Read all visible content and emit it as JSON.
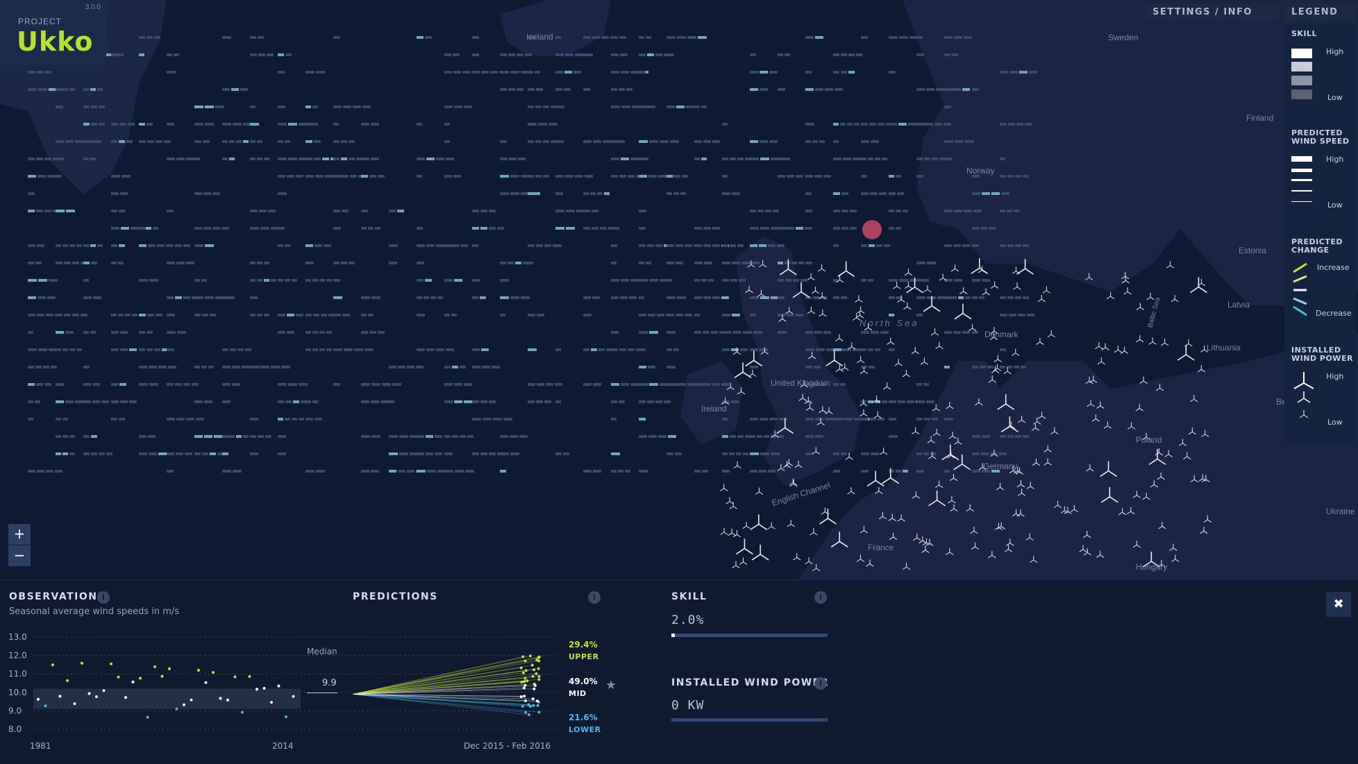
{
  "app": {
    "project_label": "PROJECT",
    "name": "Ukko",
    "version": "3.0.0"
  },
  "top_tabs": {
    "settings": "SETTINGS / INFO",
    "legend": "LEGEND"
  },
  "legend": {
    "skill": {
      "title": "SKILL",
      "high": "High",
      "low": "Low"
    },
    "wind_speed": {
      "title_line1": "PREDICTED",
      "title_line2": "WIND SPEED",
      "high": "High",
      "low": "Low"
    },
    "change": {
      "title_line1": "PREDICTED",
      "title_line2": "CHANGE",
      "increase": "Increase",
      "decrease": "Decrease"
    },
    "installed": {
      "title_line1": "INSTALLED",
      "title_line2": "WIND POWER",
      "high": "High",
      "low": "Low"
    }
  },
  "map": {
    "labels": {
      "iceland": "Iceland",
      "sweden": "Sweden",
      "finland": "Finland",
      "norway": "Norway",
      "estonia": "Estonia",
      "latvia": "Latvia",
      "lithuania": "Lithuania",
      "north_sea": "North Sea",
      "united_kingdom": "United Kingdom",
      "ireland": "Ireland",
      "denmark": "Denmark",
      "germany": "Germany",
      "poland": "Poland",
      "english_channel": "English Channel",
      "france": "France",
      "hungary": "Hungary",
      "ukraine": "Ukraine",
      "baltic": "Baltic Sea",
      "belarus": "Be"
    },
    "colors": {
      "land": "#1c2446",
      "sea": "#0e1a33",
      "marker": "#c74a6a"
    }
  },
  "zoom": {
    "in": "+",
    "out": "−"
  },
  "observations": {
    "title": "OBSERVATIONS",
    "info": "i",
    "subtitle": "Seasonal average wind speeds in m/s",
    "y_ticks": [
      "13.0",
      "12.0",
      "11.0",
      "10.0",
      "9.0",
      "8.0"
    ],
    "x_start": "1981",
    "x_end": "2014",
    "median_label": "Median",
    "median_value": "9.9"
  },
  "predictions": {
    "title": "PREDICTIONS",
    "info": "i",
    "period": "Dec 2015 - Feb 2016",
    "upper_pct": "29.4%",
    "upper_label": "UPPER",
    "mid_pct": "49.0%",
    "mid_label": "MID",
    "lower_pct": "21.6%",
    "lower_label": "LOWER",
    "star": "★",
    "colors": {
      "upper": "#c8e03a",
      "mid": "#ffffff",
      "lower": "#4fb6e6"
    }
  },
  "skill": {
    "title": "SKILL",
    "info": "i",
    "value": "2.0%",
    "fraction": 0.02
  },
  "installed_power": {
    "title": "INSTALLED WIND POWER",
    "info": "i",
    "value": "0 KW",
    "fraction": 0
  },
  "close_label": "✖"
}
